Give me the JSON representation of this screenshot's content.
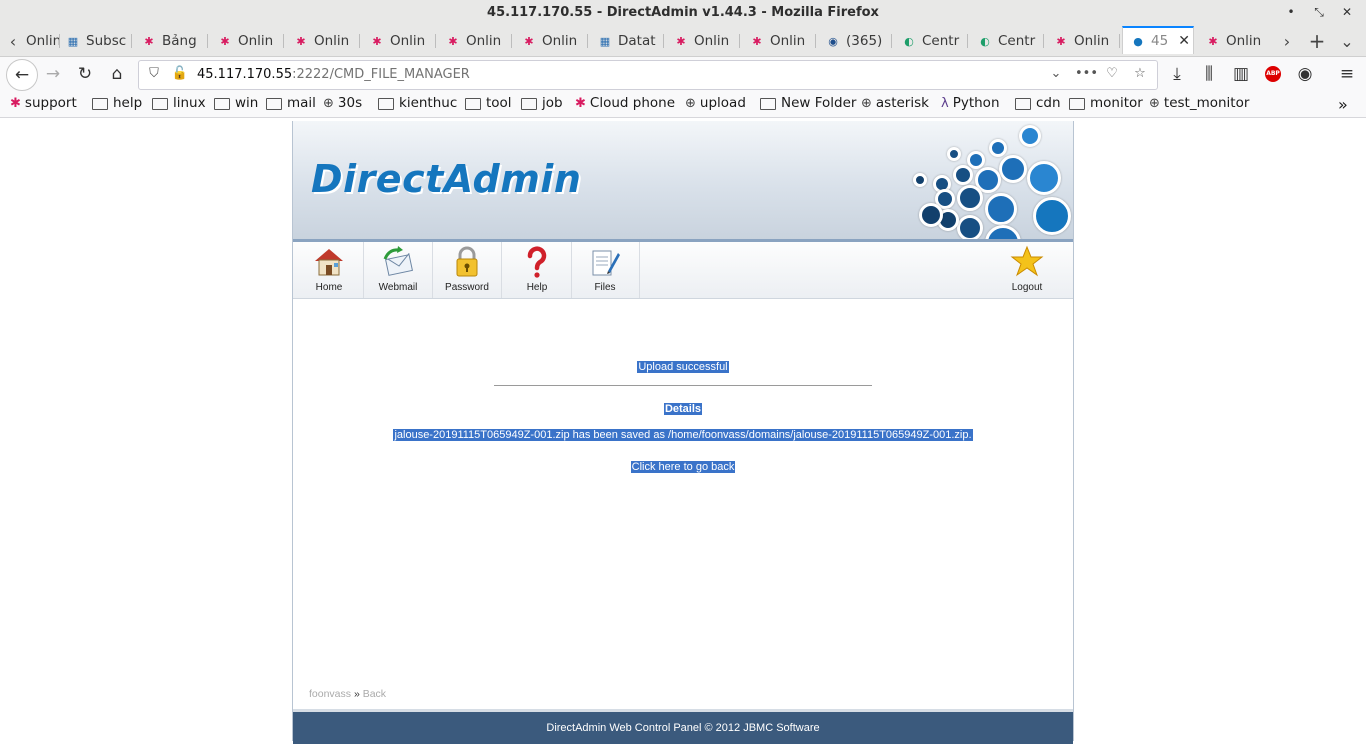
{
  "window": {
    "title": "45.117.170.55 - DirectAdmin v1.44.3 - Mozilla Firefox"
  },
  "tabs": [
    {
      "label": "Onlin"
    },
    {
      "label": "Subsc"
    },
    {
      "label": "Bảng"
    },
    {
      "label": "Onlin"
    },
    {
      "label": "Onlin"
    },
    {
      "label": "Onlin"
    },
    {
      "label": "Onlin"
    },
    {
      "label": "Onlin"
    },
    {
      "label": "Datat"
    },
    {
      "label": "Onlin"
    },
    {
      "label": "Onlin"
    },
    {
      "label": "(365)"
    },
    {
      "label": "Centr"
    },
    {
      "label": "Centr"
    },
    {
      "label": "Onlin"
    },
    {
      "label": "45"
    },
    {
      "label": "Onlin"
    }
  ],
  "url": {
    "host": "45.117.170.55",
    "rest": ":2222/CMD_FILE_MANAGER"
  },
  "bookmarks": [
    {
      "label": "support"
    },
    {
      "label": "help"
    },
    {
      "label": "linux"
    },
    {
      "label": "win"
    },
    {
      "label": "mail"
    },
    {
      "label": "30s"
    },
    {
      "label": "kienthuc"
    },
    {
      "label": "tool"
    },
    {
      "label": "job"
    },
    {
      "label": "Cloud phone"
    },
    {
      "label": "upload"
    },
    {
      "label": "New Folder"
    },
    {
      "label": "asterisk"
    },
    {
      "label": "Python"
    },
    {
      "label": "cdn"
    },
    {
      "label": "monitor"
    },
    {
      "label": "test_monitor"
    }
  ],
  "da": {
    "logo": "DirectAdmin",
    "toolbar": [
      {
        "label": "Home"
      },
      {
        "label": "Webmail"
      },
      {
        "label": "Password"
      },
      {
        "label": "Help"
      },
      {
        "label": "Files"
      },
      {
        "label": "Logout"
      }
    ],
    "message": "Upload successful",
    "details_heading": "Details",
    "details_text": "jalouse-20191115T065949Z-001.zip has been saved as /home/foonvass/domains/jalouse-20191115T065949Z-001.zip.",
    "back_link": "Click here to go back",
    "breadcrumb": {
      "user": "foonvass",
      "sep": "»",
      "back": "Back"
    },
    "footer": "DirectAdmin Web Control Panel © 2012 JBMC Software"
  },
  "colors": {
    "accent": "#0a84ff",
    "selection": "#3a73c9",
    "footer_bg": "#3b5a7d",
    "logo": "#1576be"
  }
}
